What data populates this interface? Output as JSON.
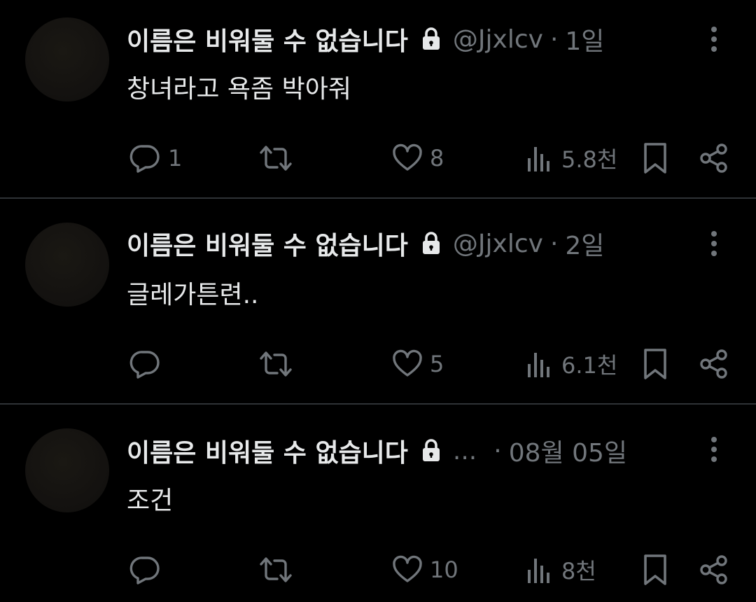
{
  "colors": {
    "background": "#000000",
    "primary_text": "#e7e9ea",
    "secondary_text": "#71767b",
    "divider": "#2f3336"
  },
  "tweets": [
    {
      "display_name": "이름은 비워둘 수 없습니다",
      "handle": "@Jjxlcv",
      "dot": "·",
      "time": "1일",
      "text": "창녀라고 욕좀 박아줘",
      "reply_count": "1",
      "like_count": "8",
      "view_count": "5.8천"
    },
    {
      "display_name": "이름은 비워둘 수 없습니다",
      "handle": "@Jjxlcv",
      "dot": "·",
      "time": "2일",
      "text": "글레가튼련..",
      "reply_count": "",
      "like_count": "5",
      "view_count": "6.1천"
    },
    {
      "display_name": "이름은 비워둘 수 없습니다",
      "handle": "...",
      "dot": "·",
      "time": "08월 05일",
      "text": "조건",
      "reply_count": "",
      "like_count": "10",
      "view_count": "8천"
    }
  ],
  "icons": {
    "lock": "lock-icon",
    "more": "more-vertical-icon",
    "reply": "reply-icon",
    "retweet": "retweet-icon",
    "like": "heart-icon",
    "views": "views-icon",
    "bookmark": "bookmark-icon",
    "share": "share-icon"
  }
}
